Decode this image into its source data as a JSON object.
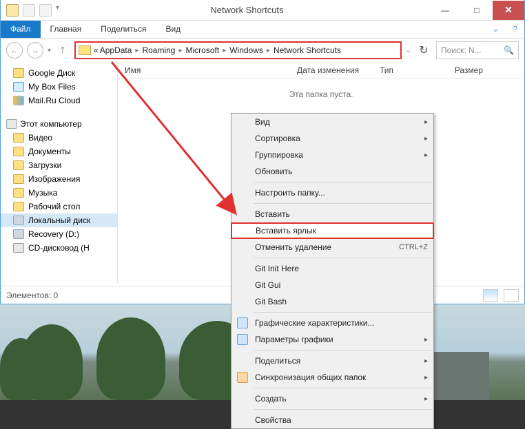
{
  "window": {
    "title": "Network Shortcuts",
    "min": "—",
    "max": "□",
    "close": "✕"
  },
  "ribbon": {
    "file": "Файл",
    "home": "Главная",
    "share": "Поделиться",
    "view": "Вид"
  },
  "address": {
    "prefix": "«",
    "crumbs": [
      "AppData",
      "Roaming",
      "Microsoft",
      "Windows",
      "Network Shortcuts"
    ]
  },
  "search": {
    "placeholder": "Поиск: N..."
  },
  "sidebar": {
    "fav": [
      {
        "label": "Google Диск"
      },
      {
        "label": "My Box Files"
      },
      {
        "label": "Mail.Ru Cloud"
      }
    ],
    "pc_header": "Этот компьютер",
    "pc": [
      {
        "label": "Видео"
      },
      {
        "label": "Документы"
      },
      {
        "label": "Загрузки"
      },
      {
        "label": "Изображения"
      },
      {
        "label": "Музыка"
      },
      {
        "label": "Рабочий стол"
      },
      {
        "label": "Локальный диск"
      },
      {
        "label": "Recovery (D:)"
      },
      {
        "label": "CD-дисковод (H"
      }
    ]
  },
  "columns": {
    "name": "Имя",
    "date": "Дата изменения",
    "type": "Тип",
    "size": "Размер"
  },
  "empty_text": "Эта папка пуста.",
  "status": {
    "items": "Элементов: 0"
  },
  "menu": {
    "view": "Вид",
    "sort": "Сортировка",
    "group": "Группировка",
    "refresh": "Обновить",
    "customize": "Настроить папку...",
    "paste": "Вставить",
    "paste_shortcut": "Вставить ярлык",
    "undo_delete": "Отменить удаление",
    "undo_kb": "CTRL+Z",
    "git_init": "Git Init Here",
    "git_gui": "Git Gui",
    "git_bash": "Git Bash",
    "gfx_props": "Графические характеристики...",
    "gfx_params": "Параметры графики",
    "share": "Поделиться",
    "sync": "Синхронизация общих папок",
    "new": "Создать",
    "props": "Свойства"
  }
}
